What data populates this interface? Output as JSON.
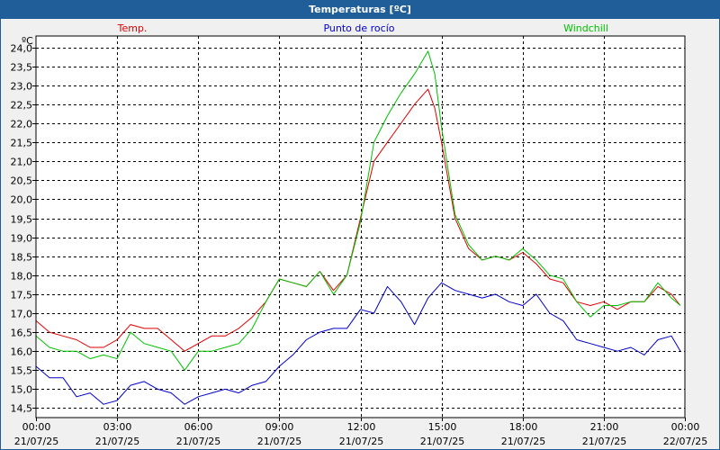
{
  "window": {
    "title": "Temperaturas [ºC]"
  },
  "chart_data": {
    "type": "line",
    "title": "Temperaturas [ºC]",
    "ylabel": "ºC",
    "xlabel": "",
    "ylim": [
      14.25,
      24.3
    ],
    "yticks": [
      "14,5",
      "15,0",
      "15,5",
      "16,0",
      "16,5",
      "17,0",
      "17,5",
      "18,0",
      "18,5",
      "19,0",
      "19,5",
      "20,0",
      "20,5",
      "21,0",
      "21,5",
      "22,0",
      "22,5",
      "23,0",
      "23,5",
      "24,0"
    ],
    "xticks": [
      {
        "time": "00:00",
        "date": "21/07/25"
      },
      {
        "time": "03:00",
        "date": "21/07/25"
      },
      {
        "time": "06:00",
        "date": "21/07/25"
      },
      {
        "time": "09:00",
        "date": "21/07/25"
      },
      {
        "time": "12:00",
        "date": "21/07/25"
      },
      {
        "time": "15:00",
        "date": "21/07/25"
      },
      {
        "time": "18:00",
        "date": "21/07/25"
      },
      {
        "time": "21:00",
        "date": "21/07/25"
      },
      {
        "time": "00:00",
        "date": "22/07/25"
      }
    ],
    "xlim": [
      "21/07/25 00:00",
      "22/07/25 00:00"
    ],
    "grid": true,
    "legend_position": "top",
    "series": [
      {
        "name": "Temp.",
        "color": "#e00000",
        "points": [
          [
            "00:00",
            16.8
          ],
          [
            "00:30",
            16.5
          ],
          [
            "01:00",
            16.4
          ],
          [
            "01:30",
            16.3
          ],
          [
            "02:00",
            16.1
          ],
          [
            "02:30",
            16.1
          ],
          [
            "03:00",
            16.3
          ],
          [
            "03:30",
            16.7
          ],
          [
            "04:00",
            16.6
          ],
          [
            "04:30",
            16.6
          ],
          [
            "05:00",
            16.3
          ],
          [
            "05:30",
            16.0
          ],
          [
            "06:00",
            16.2
          ],
          [
            "06:30",
            16.4
          ],
          [
            "07:00",
            16.4
          ],
          [
            "07:30",
            16.6
          ],
          [
            "08:00",
            16.9
          ],
          [
            "08:30",
            17.3
          ],
          [
            "09:00",
            17.9
          ],
          [
            "09:30",
            17.8
          ],
          [
            "10:00",
            17.7
          ],
          [
            "10:30",
            18.1
          ],
          [
            "11:00",
            17.6
          ],
          [
            "11:30",
            18.0
          ],
          [
            "12:00",
            19.5
          ],
          [
            "12:30",
            21.0
          ],
          [
            "13:00",
            21.5
          ],
          [
            "13:30",
            22.0
          ],
          [
            "14:00",
            22.5
          ],
          [
            "14:30",
            22.9
          ],
          [
            "14:45",
            22.4
          ],
          [
            "15:00",
            21.5
          ],
          [
            "15:30",
            19.5
          ],
          [
            "16:00",
            18.7
          ],
          [
            "16:30",
            18.4
          ],
          [
            "17:00",
            18.5
          ],
          [
            "17:30",
            18.4
          ],
          [
            "18:00",
            18.6
          ],
          [
            "18:30",
            18.3
          ],
          [
            "19:00",
            17.9
          ],
          [
            "19:30",
            17.8
          ],
          [
            "20:00",
            17.3
          ],
          [
            "20:30",
            17.2
          ],
          [
            "21:00",
            17.3
          ],
          [
            "21:30",
            17.1
          ],
          [
            "22:00",
            17.3
          ],
          [
            "22:30",
            17.3
          ],
          [
            "23:00",
            17.7
          ],
          [
            "23:30",
            17.5
          ],
          [
            "23:50",
            17.2
          ]
        ]
      },
      {
        "name": "Punto de rocío",
        "color": "#0000c8",
        "points": [
          [
            "00:00",
            15.6
          ],
          [
            "00:30",
            15.3
          ],
          [
            "01:00",
            15.3
          ],
          [
            "01:30",
            14.8
          ],
          [
            "02:00",
            14.9
          ],
          [
            "02:30",
            14.6
          ],
          [
            "03:00",
            14.7
          ],
          [
            "03:30",
            15.1
          ],
          [
            "04:00",
            15.2
          ],
          [
            "04:30",
            15.0
          ],
          [
            "05:00",
            14.9
          ],
          [
            "05:30",
            14.6
          ],
          [
            "06:00",
            14.8
          ],
          [
            "06:30",
            14.9
          ],
          [
            "07:00",
            15.0
          ],
          [
            "07:30",
            14.9
          ],
          [
            "08:00",
            15.1
          ],
          [
            "08:30",
            15.2
          ],
          [
            "09:00",
            15.6
          ],
          [
            "09:30",
            15.9
          ],
          [
            "10:00",
            16.3
          ],
          [
            "10:30",
            16.5
          ],
          [
            "11:00",
            16.6
          ],
          [
            "11:30",
            16.6
          ],
          [
            "12:00",
            17.1
          ],
          [
            "12:30",
            17.0
          ],
          [
            "13:00",
            17.7
          ],
          [
            "13:30",
            17.3
          ],
          [
            "14:00",
            16.7
          ],
          [
            "14:30",
            17.4
          ],
          [
            "15:00",
            17.8
          ],
          [
            "15:30",
            17.6
          ],
          [
            "16:00",
            17.5
          ],
          [
            "16:30",
            17.4
          ],
          [
            "17:00",
            17.5
          ],
          [
            "17:30",
            17.3
          ],
          [
            "18:00",
            17.2
          ],
          [
            "18:30",
            17.5
          ],
          [
            "19:00",
            17.0
          ],
          [
            "19:30",
            16.8
          ],
          [
            "20:00",
            16.3
          ],
          [
            "20:30",
            16.2
          ],
          [
            "21:00",
            16.1
          ],
          [
            "21:30",
            16.0
          ],
          [
            "22:00",
            16.1
          ],
          [
            "22:30",
            15.9
          ],
          [
            "23:00",
            16.3
          ],
          [
            "23:30",
            16.4
          ],
          [
            "23:50",
            16.0
          ]
        ]
      },
      {
        "name": "Windchill",
        "color": "#00c000",
        "points": [
          [
            "00:00",
            16.4
          ],
          [
            "00:30",
            16.1
          ],
          [
            "01:00",
            16.0
          ],
          [
            "01:30",
            16.0
          ],
          [
            "02:00",
            15.8
          ],
          [
            "02:30",
            15.9
          ],
          [
            "03:00",
            15.8
          ],
          [
            "03:30",
            16.5
          ],
          [
            "04:00",
            16.2
          ],
          [
            "04:30",
            16.1
          ],
          [
            "05:00",
            16.0
          ],
          [
            "05:30",
            15.5
          ],
          [
            "06:00",
            16.0
          ],
          [
            "06:30",
            16.0
          ],
          [
            "07:00",
            16.1
          ],
          [
            "07:30",
            16.2
          ],
          [
            "08:00",
            16.6
          ],
          [
            "08:30",
            17.3
          ],
          [
            "09:00",
            17.9
          ],
          [
            "09:30",
            17.8
          ],
          [
            "10:00",
            17.7
          ],
          [
            "10:30",
            18.1
          ],
          [
            "11:00",
            17.5
          ],
          [
            "11:30",
            18.0
          ],
          [
            "12:00",
            19.4
          ],
          [
            "12:30",
            21.5
          ],
          [
            "13:00",
            22.2
          ],
          [
            "13:30",
            22.8
          ],
          [
            "14:00",
            23.3
          ],
          [
            "14:30",
            23.9
          ],
          [
            "14:45",
            23.3
          ],
          [
            "15:00",
            21.9
          ],
          [
            "15:30",
            19.6
          ],
          [
            "16:00",
            18.8
          ],
          [
            "16:30",
            18.4
          ],
          [
            "17:00",
            18.5
          ],
          [
            "17:30",
            18.4
          ],
          [
            "18:00",
            18.7
          ],
          [
            "18:30",
            18.4
          ],
          [
            "19:00",
            18.0
          ],
          [
            "19:30",
            17.9
          ],
          [
            "20:00",
            17.3
          ],
          [
            "20:30",
            16.9
          ],
          [
            "21:00",
            17.2
          ],
          [
            "21:30",
            17.2
          ],
          [
            "22:00",
            17.3
          ],
          [
            "22:30",
            17.3
          ],
          [
            "23:00",
            17.8
          ],
          [
            "23:30",
            17.4
          ],
          [
            "23:50",
            17.2
          ]
        ]
      }
    ]
  }
}
